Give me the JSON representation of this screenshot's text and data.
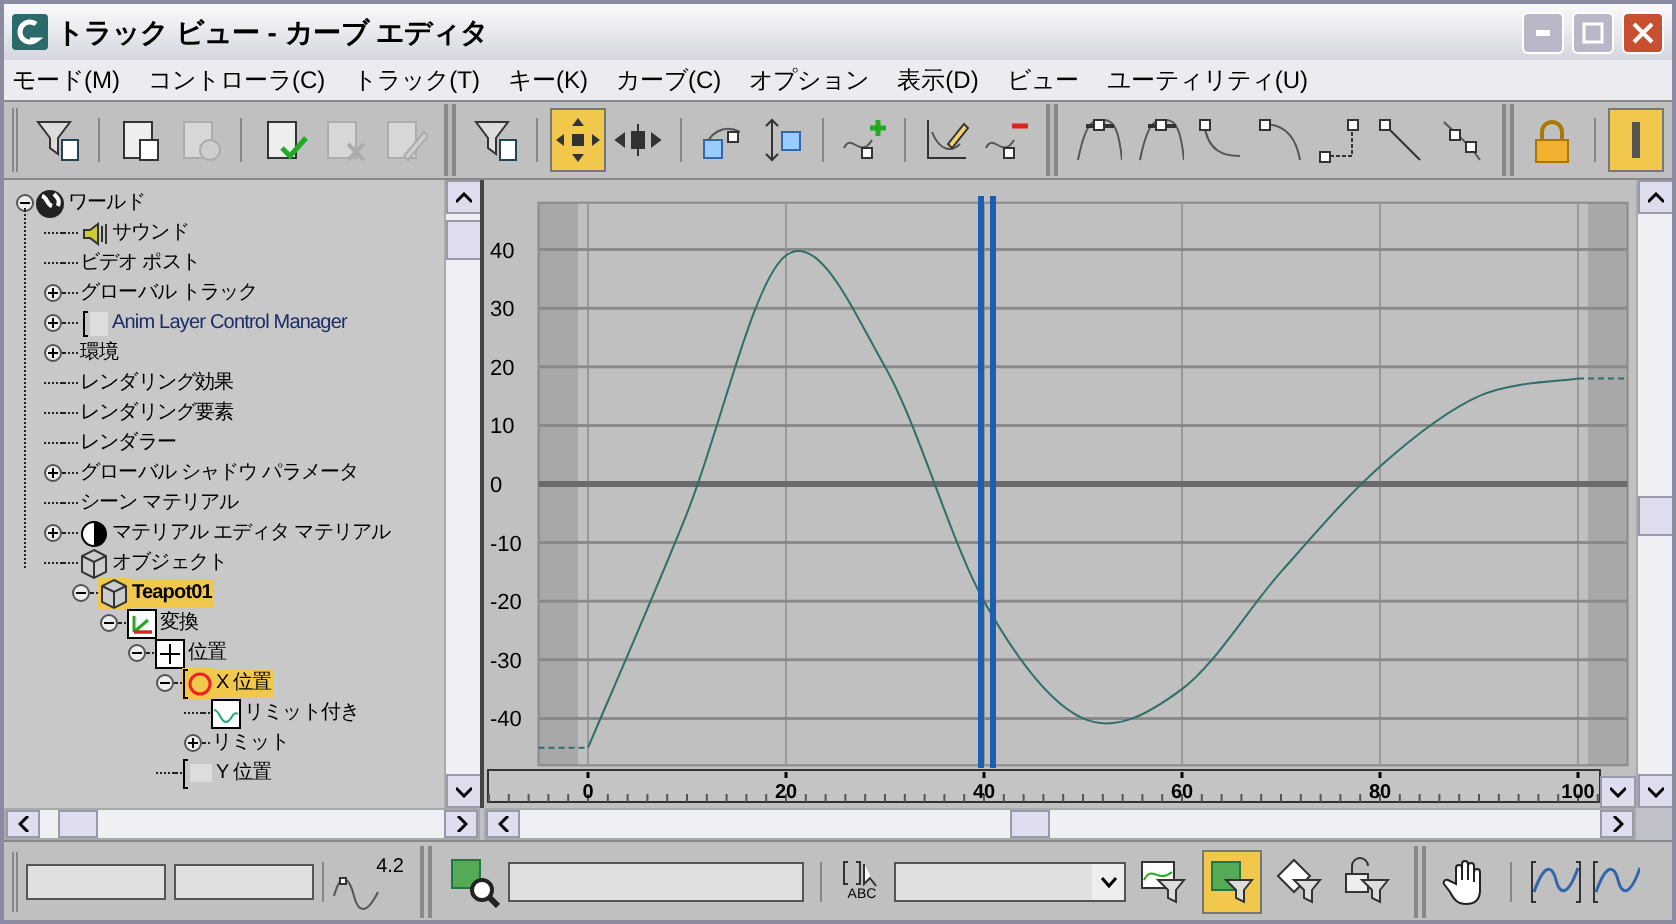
{
  "window": {
    "title": "トラック ビュー - カーブ エディタ"
  },
  "menu": [
    "モード(M)",
    "コントローラ(C)",
    "トラック(T)",
    "キー(K)",
    "カーブ(C)",
    "オプション",
    "表示(D)",
    "ビュー",
    "ユーティリティ(U)"
  ],
  "toolbar": [
    {
      "kind": "filter",
      "selected": false,
      "disabled": false
    },
    {
      "kind": "sep"
    },
    {
      "kind": "copy",
      "selected": false,
      "disabled": false
    },
    {
      "kind": "paste",
      "selected": false,
      "disabled": true
    },
    {
      "kind": "sep"
    },
    {
      "kind": "assign",
      "selected": false,
      "disabled": false
    },
    {
      "kind": "delete",
      "selected": false,
      "disabled": true
    },
    {
      "kind": "edit",
      "selected": false,
      "disabled": true
    },
    {
      "kind": "group"
    },
    {
      "kind": "filter",
      "selected": false,
      "disabled": false
    },
    {
      "kind": "sep"
    },
    {
      "kind": "move",
      "selected": true,
      "disabled": false
    },
    {
      "kind": "slide",
      "selected": false,
      "disabled": false
    },
    {
      "kind": "sep"
    },
    {
      "kind": "scale",
      "selected": false,
      "disabled": false
    },
    {
      "kind": "scale-values",
      "selected": false,
      "disabled": false
    },
    {
      "kind": "sep"
    },
    {
      "kind": "add-key",
      "selected": false,
      "disabled": false
    },
    {
      "kind": "sep"
    },
    {
      "kind": "draw",
      "selected": false,
      "disabled": false
    },
    {
      "kind": "reduce",
      "selected": false,
      "disabled": false
    },
    {
      "kind": "group"
    },
    {
      "kind": "tan-auto",
      "selected": false,
      "disabled": false
    },
    {
      "kind": "tan-custom",
      "selected": false,
      "disabled": false
    },
    {
      "kind": "tan-fast",
      "selected": false,
      "disabled": false
    },
    {
      "kind": "tan-slow",
      "selected": false,
      "disabled": false
    },
    {
      "kind": "tan-step",
      "selected": false,
      "disabled": false
    },
    {
      "kind": "tan-linear",
      "selected": false,
      "disabled": false
    },
    {
      "kind": "tan-smooth",
      "selected": false,
      "disabled": false
    },
    {
      "kind": "group"
    },
    {
      "kind": "lock",
      "selected": false,
      "disabled": false
    },
    {
      "kind": "sep"
    },
    {
      "kind": "highlight",
      "selected": true,
      "disabled": false
    }
  ],
  "tree": [
    {
      "label": "ワールド",
      "kind": "globe",
      "expanded": true,
      "selected": false,
      "children": [
        {
          "label": "サウンド",
          "kind": "speaker",
          "selected": false
        },
        {
          "label": "ビデオ ポスト",
          "kind": "plain",
          "selected": false
        },
        {
          "label": "グローバル トラック",
          "kind": "plain",
          "expanded": false,
          "selected": false
        },
        {
          "label": "Anim Layer Control Manager",
          "kind": "layer",
          "expanded": false,
          "selected": false
        },
        {
          "label": "環境",
          "kind": "plain",
          "expanded": false,
          "selected": false
        },
        {
          "label": "レンダリング効果",
          "kind": "plain",
          "selected": false
        },
        {
          "label": "レンダリング要素",
          "kind": "plain",
          "selected": false
        },
        {
          "label": "レンダラー",
          "kind": "plain",
          "selected": false
        },
        {
          "label": "グローバル シャドウ パラメータ",
          "kind": "plain",
          "expanded": false,
          "selected": false
        },
        {
          "label": "シーン マテリアル",
          "kind": "plain",
          "selected": false
        },
        {
          "label": "マテリアル エディタ マテリアル",
          "kind": "sphere",
          "expanded": false,
          "selected": false
        },
        {
          "label": "オブジェクト",
          "kind": "cube",
          "selected": false,
          "children": [
            {
              "label": "Teapot01",
              "kind": "object",
              "expanded": true,
              "selected": true,
              "children": [
                {
                  "label": "変換",
                  "kind": "transform",
                  "expanded": true,
                  "selected": false,
                  "children": [
                    {
                      "label": "位置",
                      "kind": "position",
                      "expanded": true,
                      "selected": false,
                      "children": [
                        {
                          "label": "X 位置",
                          "kind": "controller",
                          "expanded": true,
                          "selected": true,
                          "children": [
                            {
                              "label": "リミット付き",
                              "kind": "curve",
                              "selected": false
                            },
                            {
                              "label": "リミット",
                              "kind": "plain",
                              "expanded": false,
                              "selected": false
                            }
                          ]
                        },
                        {
                          "label": "Y 位置",
                          "kind": "bracket",
                          "selected": false
                        }
                      ]
                    }
                  ]
                }
              ]
            }
          ]
        }
      ]
    }
  ],
  "graph": {
    "chart_data": {
      "type": "line",
      "x": [
        0,
        10,
        20,
        30,
        40,
        50,
        60,
        70,
        80,
        90,
        100
      ],
      "series": [
        {
          "color": "#2f6f68",
          "values": [
            -45,
            -5,
            39,
            20,
            -20,
            -40,
            -35,
            -15,
            3,
            15,
            18
          ]
        }
      ],
      "xlim": [
        -5,
        105
      ],
      "ylim": [
        -48,
        48
      ],
      "xticks": [
        0,
        20,
        40,
        60,
        80,
        100
      ],
      "yticks": [
        -40,
        -30,
        -20,
        -10,
        0,
        10,
        20,
        30,
        40
      ],
      "grid": true
    },
    "time_slider": {
      "level": 0.4
    }
  },
  "bottom": {
    "curve_value": "4.2",
    "abc_label": "ABC",
    "filters": [
      {
        "kind": "curve-filter",
        "selected": false
      },
      {
        "kind": "object-filter",
        "selected": true
      },
      {
        "kind": "keys-filter",
        "selected": false
      },
      {
        "kind": "lock-filter",
        "selected": false
      }
    ]
  }
}
